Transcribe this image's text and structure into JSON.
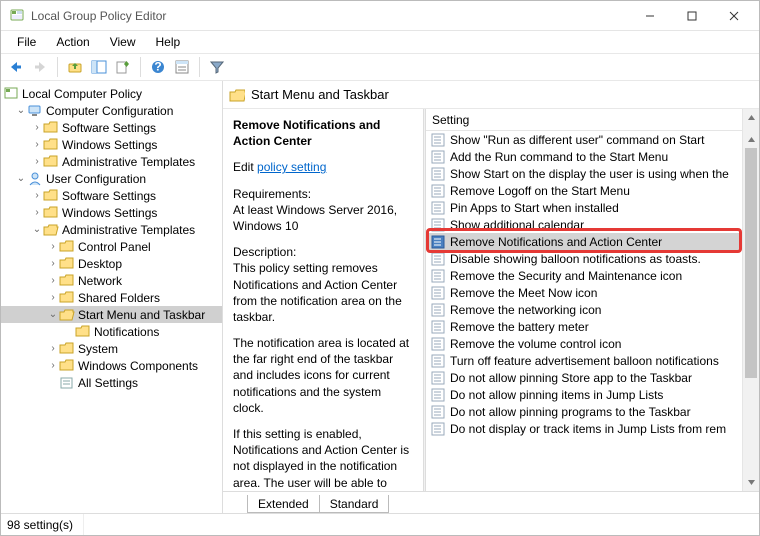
{
  "title": "Local Group Policy Editor",
  "menus": [
    "File",
    "Action",
    "View",
    "Help"
  ],
  "tree": {
    "root": "Local Computer Policy",
    "cc": "Computer Configuration",
    "cc_children": [
      "Software Settings",
      "Windows Settings",
      "Administrative Templates"
    ],
    "uc": "User Configuration",
    "uc_children": [
      "Software Settings",
      "Windows Settings"
    ],
    "uc_at": "Administrative Templates",
    "at_children_top": [
      "Control Panel",
      "Desktop",
      "Network",
      "Shared Folders"
    ],
    "at_sm": "Start Menu and Taskbar",
    "sm_child": "Notifications",
    "at_children_bot": [
      "System",
      "Windows Components"
    ],
    "at_allsettings": "All Settings"
  },
  "crumb": "Start Menu and Taskbar",
  "detail": {
    "title": "Remove Notifications and Action Center",
    "edit_prefix": "Edit ",
    "edit_link": "policy setting ",
    "req_label": "Requirements:",
    "req_text": "At least Windows Server 2016, Windows 10",
    "desc_label": "Description:",
    "desc1": "This policy setting removes Notifications and Action Center from the notification area on the taskbar.",
    "desc2": "The notification area is located at the far right end of the taskbar and includes icons for current notifications and the system clock.",
    "desc3": "If this setting is enabled, Notifications and Action Center is not displayed in the notification area. The user will be able to read"
  },
  "list_header": "Setting",
  "settings": [
    "Show \"Run as different user\" command on Start",
    "Add the Run command to the Start Menu",
    "Show Start on the display the user is using when the",
    "Remove Logoff on the Start Menu",
    "Pin Apps to Start when installed",
    "Show additional calendar",
    "Remove Notifications and Action Center",
    "Disable showing balloon notifications as toasts.",
    "Remove the Security and Maintenance icon",
    "Remove the Meet Now icon",
    "Remove the networking icon",
    "Remove the battery meter",
    "Remove the volume control icon",
    "Turn off feature advertisement balloon notifications",
    "Do not allow pinning Store app to the Taskbar",
    "Do not allow pinning items in Jump Lists",
    "Do not allow pinning programs to the Taskbar",
    "Do not display or track items in Jump Lists from rem"
  ],
  "selected_index": 6,
  "tabs": [
    "Extended",
    "Standard"
  ],
  "status": "98 setting(s)"
}
